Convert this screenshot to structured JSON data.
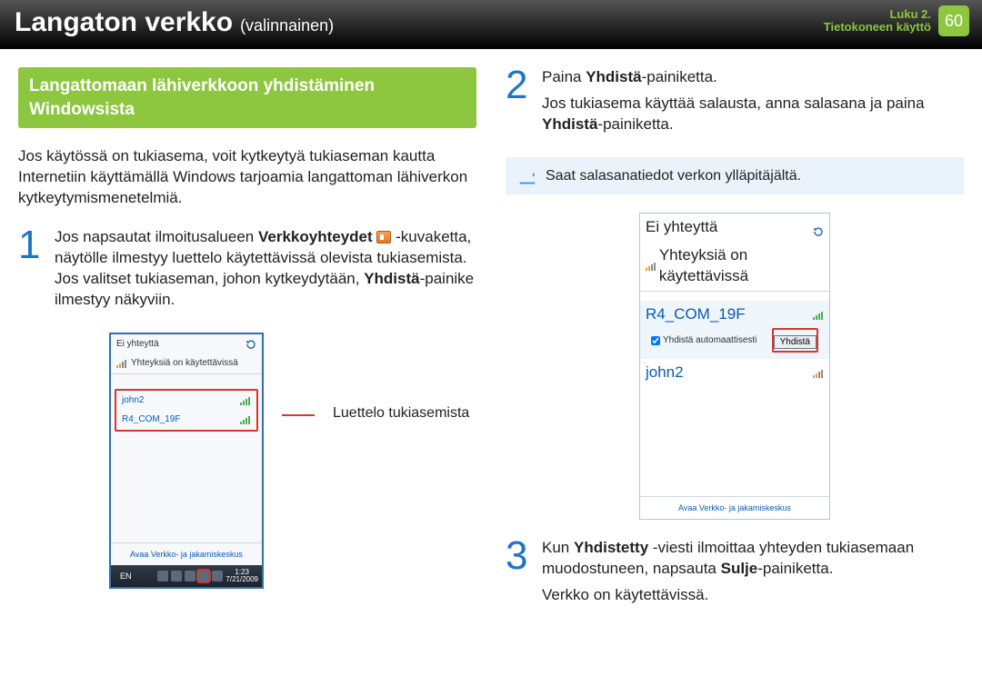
{
  "header": {
    "title": "Langaton verkko",
    "subtitle": "(valinnainen)",
    "chapter_line1": "Luku 2.",
    "chapter_line2": "Tietokoneen käyttö",
    "page_number": "60"
  },
  "section_title": "Langattomaan lähiverkkoon yhdistäminen Windowsista",
  "intro": "Jos käytössä on tukiasema, voit kytkeytyä tukiaseman kautta Internetiin käyttämällä Windows tarjoamia langattoman lähiverkon kytkeytymismenetelmiä.",
  "step1": {
    "num": "1",
    "t1a": "Jos napsautat ilmoitusalueen ",
    "t1b": "Verkkoyhteydet",
    "t1c": " -kuvaketta, näytölle ilmestyy luettelo käytettävissä olevista tukiasemista. Jos valitset tukiaseman, johon kytkeydytään, ",
    "t1d": "Yhdistä",
    "t1e": "-painike ilmestyy näkyviin."
  },
  "callout_label": "Luettelo tukiasemista",
  "step2": {
    "num": "2",
    "l1a": "Paina ",
    "l1b": "Yhdistä",
    "l1c": "-painiketta.",
    "l2a": "Jos tukiasema käyttää salausta, anna salasana ja paina ",
    "l2b": "Yhdistä",
    "l2c": "-painiketta."
  },
  "info_note": "Saat salasanatiedot verkon ylläpitäjältä.",
  "step3": {
    "num": "3",
    "l1a": "Kun ",
    "l1b": "Yhdistetty",
    "l1c": " -viesti ilmoittaa yhteyden tukiasemaan muodostuneen, napsauta ",
    "l1d": "Sulje",
    "l1e": "-painiketta.",
    "l2": "Verkko on käytettävissä."
  },
  "mock": {
    "no_conn": "Ei yhteyttä",
    "avail": "Yhteyksiä on käytettävissä",
    "ap1": "john2",
    "ap2": "R4_COM_19F",
    "open_center": "Avaa Verkko- ja jakamiskeskus",
    "lang": "EN",
    "time": "1:23",
    "date": "7/21/2009",
    "auto": "Yhdistä automaattisesti",
    "connect": "Yhdistä"
  }
}
